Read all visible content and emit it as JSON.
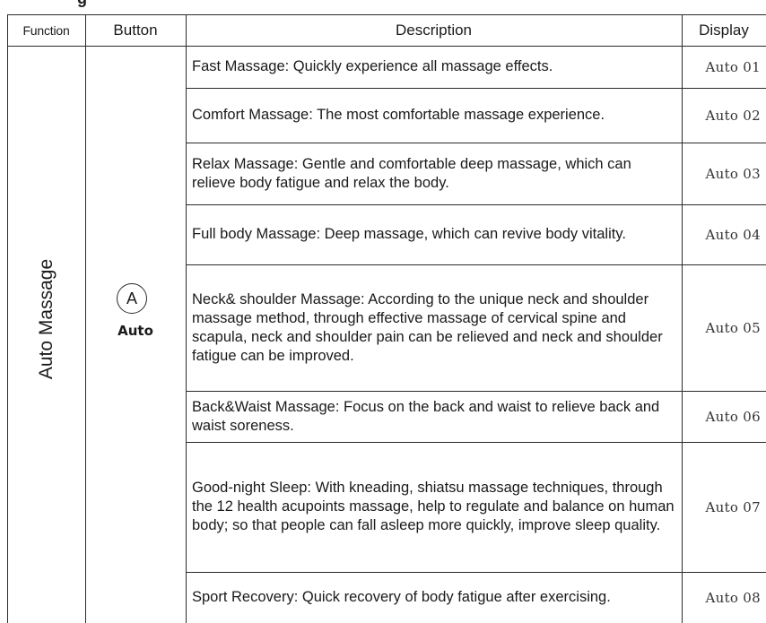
{
  "section_heading_fragment": "g",
  "table": {
    "headers": {
      "function": "Function",
      "button": "Button",
      "description": "Description",
      "display": "Display"
    },
    "function_label": "Auto Massage",
    "button": {
      "icon_letter": "A",
      "label": "Auto"
    },
    "rows": [
      {
        "description": "Fast Massage: Quickly experience all massage effects.",
        "display": "Auto 01"
      },
      {
        "description": "Comfort Massage: The most comfortable massage experience.",
        "display": "Auto 02"
      },
      {
        "description": "Relax Massage: Gentle and comfortable deep massage, which can relieve body fatigue and relax the body.",
        "display": "Auto 03"
      },
      {
        "description": "Full body Massage: Deep massage, which can revive body vitality.",
        "display": "Auto 04"
      },
      {
        "description": "Neck& shoulder Massage: According to the unique neck and shoulder massage method, through effective massage of cervical spine and scapula, neck and shoulder pain can be relieved and neck and shoulder fatigue can be improved.",
        "display": "Auto 05"
      },
      {
        "description": "Back&Waist Massage: Focus on the back and waist to relieve back and waist soreness.",
        "display": "Auto 06"
      },
      {
        "description": "Good-night Sleep: With kneading, shiatsu massage techniques, through the 12 health acupoints massage, help to regulate and balance on human body; so that people can fall asleep more quickly, improve sleep quality.",
        "display": "Auto 07"
      },
      {
        "description": "Sport Recovery: Quick recovery of body fatigue after exercising.",
        "display": "Auto 08"
      }
    ]
  }
}
